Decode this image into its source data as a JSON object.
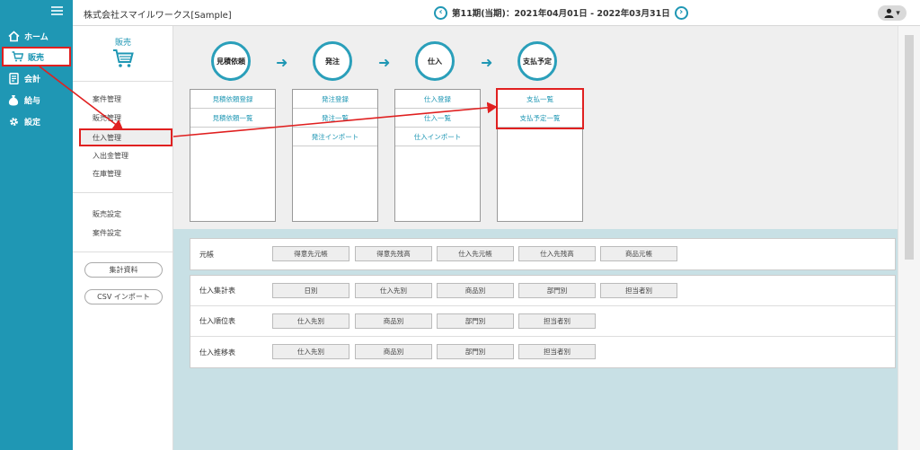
{
  "header": {
    "company": "株式会社スマイルワークス[Sample]",
    "prev_symbol": "‹",
    "next_symbol": "›",
    "period": "第11期(当期)：2021年04月01日 - 2022年03月31日",
    "user_caret": "▾"
  },
  "nav": {
    "items": [
      {
        "label": "ホーム",
        "icon": "home-icon"
      },
      {
        "label": "販売",
        "icon": "cart-icon"
      },
      {
        "label": "会計",
        "icon": "ledger-icon"
      },
      {
        "label": "給与",
        "icon": "money-bag-icon"
      },
      {
        "label": "設定",
        "icon": "gear-icon"
      }
    ]
  },
  "submenu": {
    "title": "販売",
    "group1": [
      "案件管理",
      "販売管理",
      "仕入管理",
      "入出金管理",
      "在庫管理"
    ],
    "group2": [
      "販売設定",
      "案件設定"
    ],
    "buttons": [
      "集計資料",
      "CSV インポート"
    ]
  },
  "flow": {
    "steps": [
      {
        "label": "見積依頼",
        "links": [
          "見積依頼登録",
          "見積依頼一覧"
        ]
      },
      {
        "label": "発注",
        "links": [
          "発注登録",
          "発注一覧",
          "発注インポート"
        ]
      },
      {
        "label": "仕入",
        "links": [
          "仕入登録",
          "仕入一覧",
          "仕入インポート"
        ]
      },
      {
        "label": "支払予定",
        "links": [
          "支払一覧",
          "支払予定一覧"
        ]
      }
    ],
    "arrow": "➜"
  },
  "reports": {
    "ledger": {
      "label": "元帳",
      "buttons": [
        "得意先元帳",
        "得意先残高",
        "仕入先元帳",
        "仕入先残高",
        "商品元帳"
      ]
    },
    "rows": [
      {
        "label": "仕入集計表",
        "buttons": [
          "日別",
          "仕入先別",
          "商品別",
          "部門別",
          "担当者別"
        ]
      },
      {
        "label": "仕入順位表",
        "buttons": [
          "仕入先別",
          "商品別",
          "部門別",
          "担当者別"
        ]
      },
      {
        "label": "仕入推移表",
        "buttons": [
          "仕入先別",
          "商品別",
          "部門別",
          "担当者別"
        ]
      }
    ]
  },
  "colors": {
    "accent": "#1f97b4",
    "annotation": "#e02020"
  }
}
